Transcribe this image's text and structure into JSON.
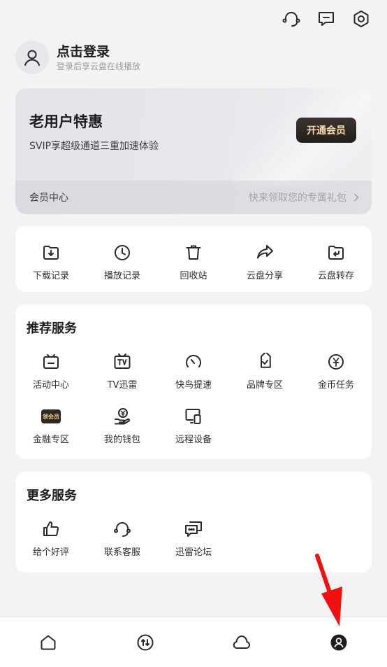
{
  "profile": {
    "title": "点击登录",
    "subtitle": "登录后享云盘在线播放"
  },
  "vip": {
    "title": "老用户特惠",
    "subtitle": "SVIP享超级通道三重加速体验",
    "button": "开通会员",
    "center_label": "会员中心",
    "gift_label": "快来领取您的专属礼包"
  },
  "quick_actions": [
    {
      "label": "下载记录",
      "icon": "download-icon"
    },
    {
      "label": "播放记录",
      "icon": "clock-icon"
    },
    {
      "label": "回收站",
      "icon": "trash-icon"
    },
    {
      "label": "云盘分享",
      "icon": "share-icon"
    },
    {
      "label": "云盘转存",
      "icon": "folder-save-icon"
    }
  ],
  "recommended": {
    "title": "推荐服务",
    "items": [
      {
        "label": "活动中心",
        "icon": "activity-icon"
      },
      {
        "label": "TV迅雷",
        "icon": "tv-icon"
      },
      {
        "label": "快鸟提速",
        "icon": "speedometer-icon"
      },
      {
        "label": "品牌专区",
        "icon": "brand-tag-icon"
      },
      {
        "label": "金币任务",
        "icon": "coin-icon"
      },
      {
        "label": "金融专区",
        "icon": "finance-badge-icon",
        "badge": "领会员"
      },
      {
        "label": "我的钱包",
        "icon": "wallet-icon"
      },
      {
        "label": "远程设备",
        "icon": "remote-device-icon"
      }
    ]
  },
  "more": {
    "title": "更多服务",
    "items": [
      {
        "label": "给个好评",
        "icon": "thumbs-up-icon"
      },
      {
        "label": "联系客服",
        "icon": "headset-icon"
      },
      {
        "label": "迅雷论坛",
        "icon": "forum-icon"
      }
    ]
  },
  "bottom_nav": [
    {
      "icon": "home-icon"
    },
    {
      "icon": "transfer-icon"
    },
    {
      "icon": "cloud-icon"
    },
    {
      "icon": "profile-icon",
      "active": true
    }
  ],
  "colors": {
    "background": "#f3f3f4",
    "vip_button": "#2b2522",
    "vip_button_text": "#f6dcb0",
    "annotation_arrow": "#f01010"
  }
}
